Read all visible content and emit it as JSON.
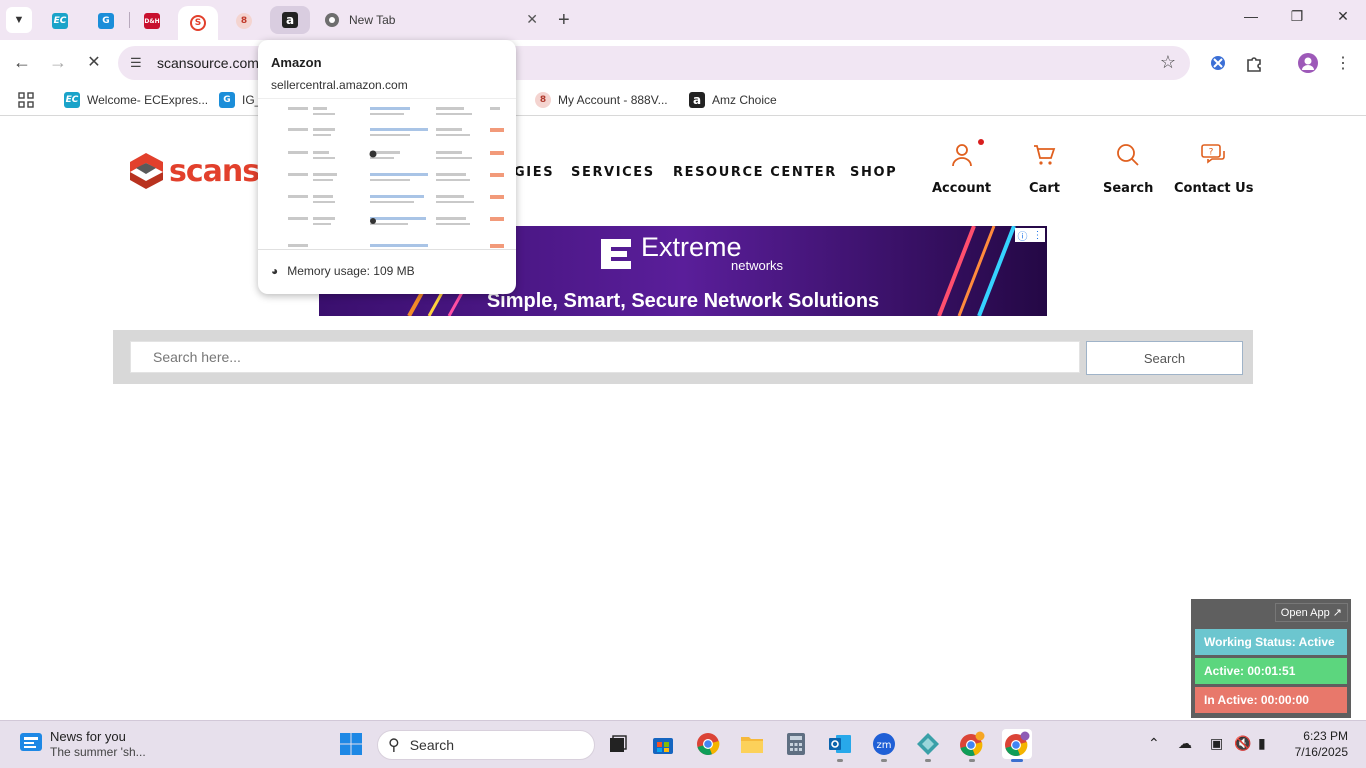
{
  "browser": {
    "tabs": {
      "new_tab_title": "New Tab",
      "pinned": [
        {
          "name": "ECExpress",
          "glyph": "EC",
          "color": "#1aa3c9"
        },
        {
          "name": "Site",
          "glyph": "G",
          "color": "#1b8ed9"
        },
        {
          "name": "D&H",
          "glyph": "D&H",
          "color": "#c8102e"
        },
        {
          "name": "ScanSource",
          "glyph": "S",
          "color": "#e2402c"
        },
        {
          "name": "Tab",
          "glyph": "8",
          "color": "#c0392b"
        },
        {
          "name": "Amazon",
          "glyph": "a",
          "color": "#222222"
        }
      ]
    },
    "address": {
      "url": "scansource.com/"
    },
    "bookmarks": [
      {
        "label": "Welcome- ECExpres...",
        "glyph": "EC",
        "color": "#1aa3c9"
      },
      {
        "label": "IG_",
        "glyph": "G",
        "color": "#1b8ed9"
      },
      {
        "label": "My Account - 888V...",
        "glyph": "8",
        "color": "#b03a2e"
      },
      {
        "label": "Amz Choice",
        "glyph": "a",
        "color": "#222222"
      }
    ]
  },
  "hovercard": {
    "title": "Amazon",
    "url": "sellercentral.amazon.com",
    "memory": "Memory usage: 109 MB"
  },
  "site": {
    "logo_text": "scanso",
    "nav": {
      "technologies_partial": "GIES",
      "services": "SERVICES",
      "resource_center": "RESOURCE CENTER",
      "shop": "SHOP"
    },
    "utility": {
      "account": "Account",
      "cart": "Cart",
      "search": "Search",
      "contact": "Contact Us"
    },
    "banner": {
      "brand": "Extreme",
      "brand_sub": "networks",
      "tagline": "Simple, Smart, Secure Network Solutions"
    },
    "search": {
      "placeholder": "Search here...",
      "button": "Search"
    }
  },
  "tracker": {
    "open_app": "Open App ↗",
    "working": "Working Status: Active",
    "active": "Active: 00:01:51",
    "inactive": "In Active: 00:00:00",
    "colors": {
      "working": "#6cc6cf",
      "active": "#5cd67e",
      "inactive": "#e8786b"
    }
  },
  "taskbar": {
    "news_title": "News for you",
    "news_sub": "The summer 'sh...",
    "search_placeholder": "Search",
    "time": "6:23 PM",
    "date": "7/16/2025"
  }
}
